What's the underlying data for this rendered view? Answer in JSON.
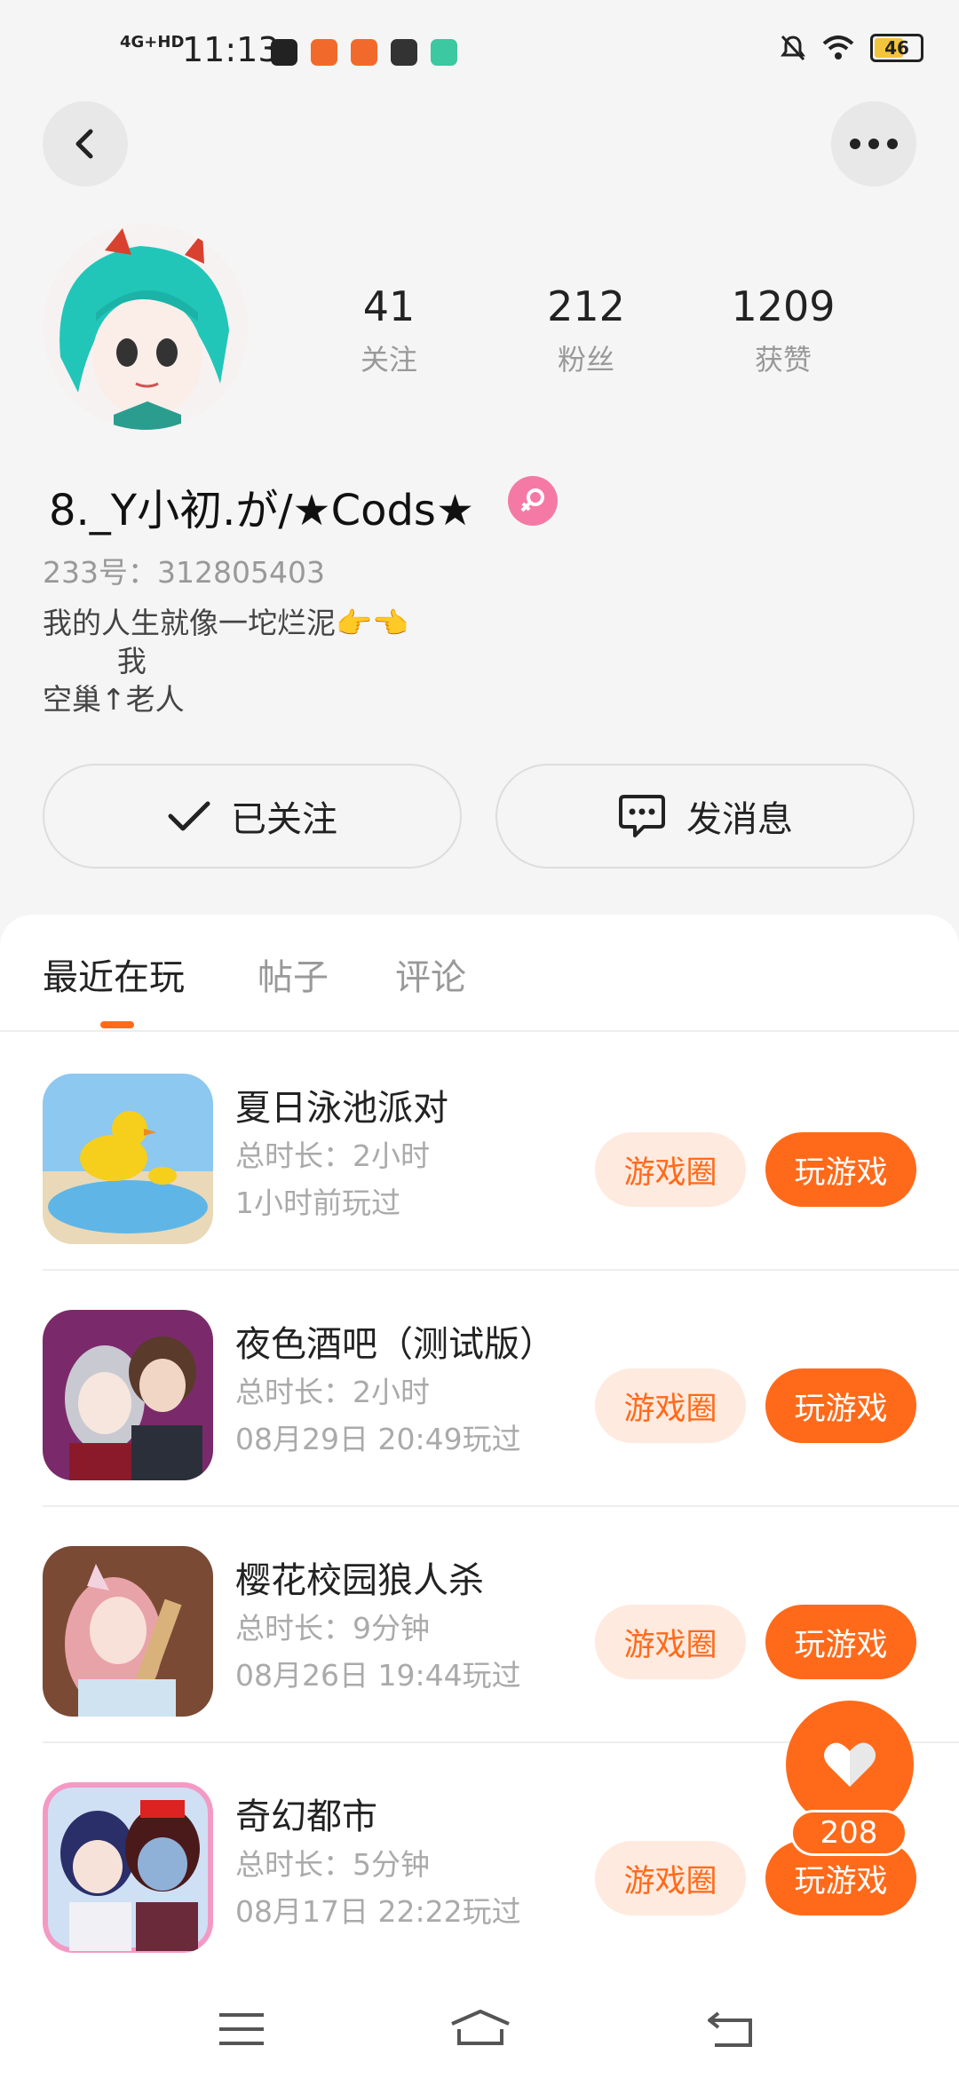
{
  "status_bar": {
    "network": "4G+HD",
    "time": "11:13",
    "battery": "46",
    "app_icon_colors": [
      "#222222",
      "#f26a2b",
      "#f26a2b",
      "#333333",
      "#3cc8a0"
    ]
  },
  "profile": {
    "stats": [
      {
        "value": "41",
        "label": "关注"
      },
      {
        "value": "212",
        "label": "粉丝"
      },
      {
        "value": "1209",
        "label": "获赞"
      }
    ],
    "username": "8._Y小初.が/★Cods★",
    "uid": "233号：312805403",
    "bio": "我的人生就像一坨烂泥👉👈\n        我\n空巢↑老人",
    "following_label": "已关注",
    "message_label": "发消息"
  },
  "tabs": [
    {
      "label": "最近在玩",
      "active": true
    },
    {
      "label": "帖子",
      "active": false
    },
    {
      "label": "评论",
      "active": false
    }
  ],
  "games": [
    {
      "title": "夏日泳池派对",
      "duration": "总时长：2小时",
      "last_played": "1小时前玩过",
      "circle_label": "游戏圈",
      "play_label": "玩游戏"
    },
    {
      "title": "夜色酒吧（测试版）",
      "duration": "总时长：2小时",
      "last_played": "08月29日 20:49玩过",
      "circle_label": "游戏圈",
      "play_label": "玩游戏"
    },
    {
      "title": "樱花校园狼人杀",
      "duration": "总时长：9分钟",
      "last_played": "08月26日 19:44玩过",
      "circle_label": "游戏圈",
      "play_label": "玩游戏"
    },
    {
      "title": "奇幻都市",
      "duration": "总时长：5分钟",
      "last_played": "08月17日 22:22玩过",
      "circle_label": "游戏圈",
      "play_label": "玩游戏"
    }
  ],
  "like_fab": {
    "count": "208"
  },
  "colors": {
    "accent": "#ff6a1a",
    "accent_light": "#ffeadf",
    "gender_badge": "#f47aa5",
    "background": "#f5f5f5"
  }
}
